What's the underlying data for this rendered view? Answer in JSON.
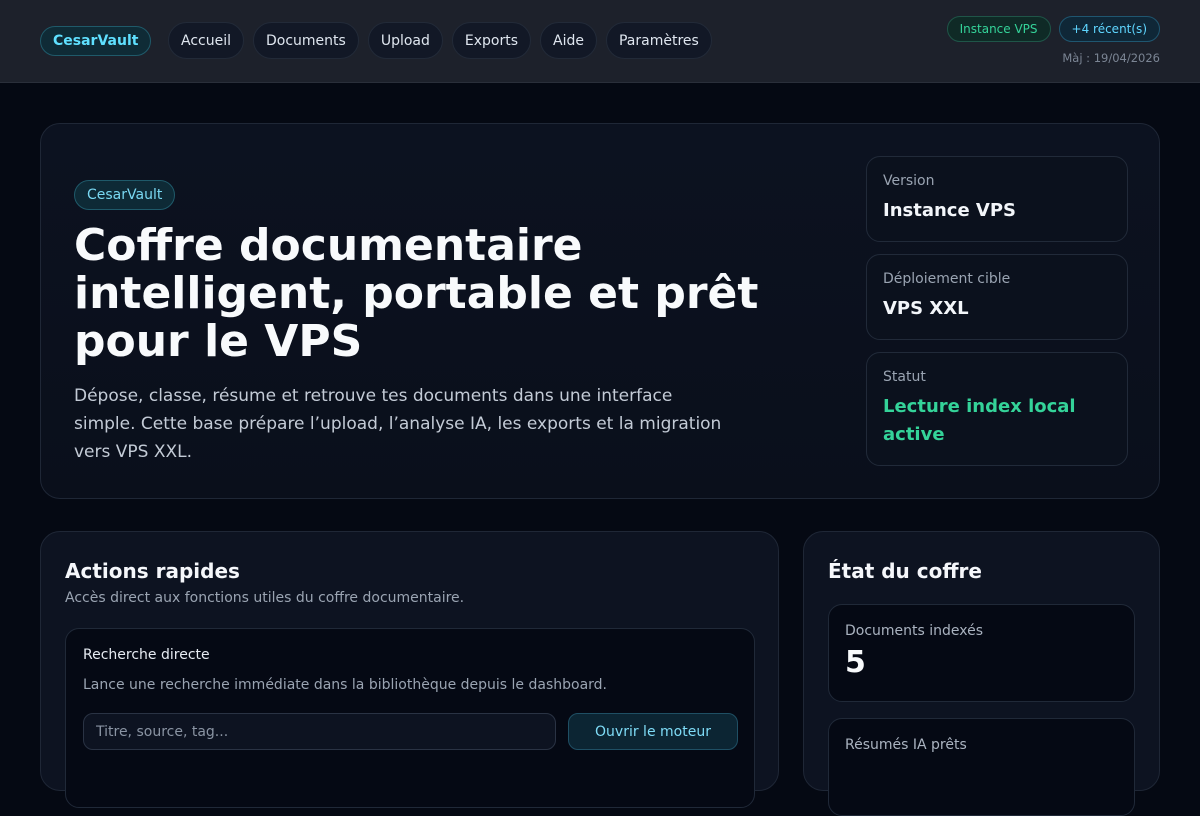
{
  "topbar": {
    "brand": "CesarVault",
    "nav": [
      "Accueil",
      "Documents",
      "Upload",
      "Exports",
      "Aide",
      "Paramètres"
    ],
    "badge_instance": "Instance VPS",
    "badge_recent": "+4 récent(s)",
    "updated": "Màj : 19/04/2026"
  },
  "hero": {
    "pill": "CesarVault",
    "title": "Coffre documentaire intelligent, portable et prêt pour le VPS",
    "description": "Dépose, classe, résume et retrouve tes documents dans une interface simple. Cette base prépare l’upload, l’analyse IA, les exports et la migration vers VPS XXL.",
    "cards": [
      {
        "label": "Version",
        "value": "Instance VPS"
      },
      {
        "label": "Déploiement cible",
        "value": "VPS XXL"
      },
      {
        "label": "Statut",
        "value": "Lecture index local active"
      }
    ]
  },
  "actions": {
    "title": "Actions rapides",
    "subtitle": "Accès direct aux fonctions utiles du coffre documentaire.",
    "search": {
      "title": "Recherche directe",
      "description": "Lance une recherche immédiate dans la bibliothèque depuis le dashboard.",
      "placeholder": "Titre, source, tag...",
      "button": "Ouvrir le moteur"
    }
  },
  "state": {
    "title": "État du coffre",
    "stats": [
      {
        "label": "Documents indexés",
        "value": "5"
      },
      {
        "label": "Résumés IA prêts",
        "value": ""
      }
    ]
  },
  "colors": {
    "accent_cyan": "#5fe0ff",
    "status_green": "#34d399",
    "background": "#050913"
  }
}
